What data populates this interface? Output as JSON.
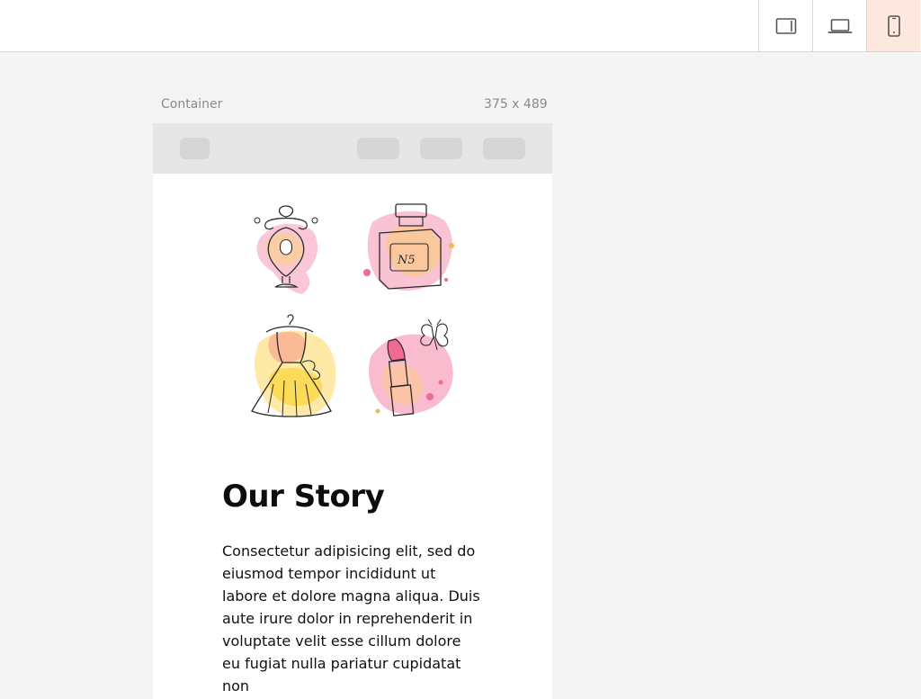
{
  "toolbar": {
    "devices": [
      {
        "name": "tablet",
        "icon": "tablet-icon",
        "active": false
      },
      {
        "name": "laptop",
        "icon": "laptop-icon",
        "active": false
      },
      {
        "name": "mobile",
        "icon": "mobile-icon",
        "active": true
      }
    ],
    "active_color": "#fde8df"
  },
  "canvas": {
    "label": "Container",
    "size": "375 x 489"
  },
  "content": {
    "illustrations": [
      "perfume-bottle-icon",
      "no5-perfume-icon",
      "dress-icon",
      "lipstick-butterfly-icon"
    ],
    "title": "Our Story",
    "body": "Consectetur adipisicing elit, sed do eiusmod tempor incididunt ut labore et dolore magna aliqua. Duis aute irure dolor in reprehenderit in voluptate velit esse cillum dolore eu fugiat nulla pariatur cupidatat non"
  }
}
